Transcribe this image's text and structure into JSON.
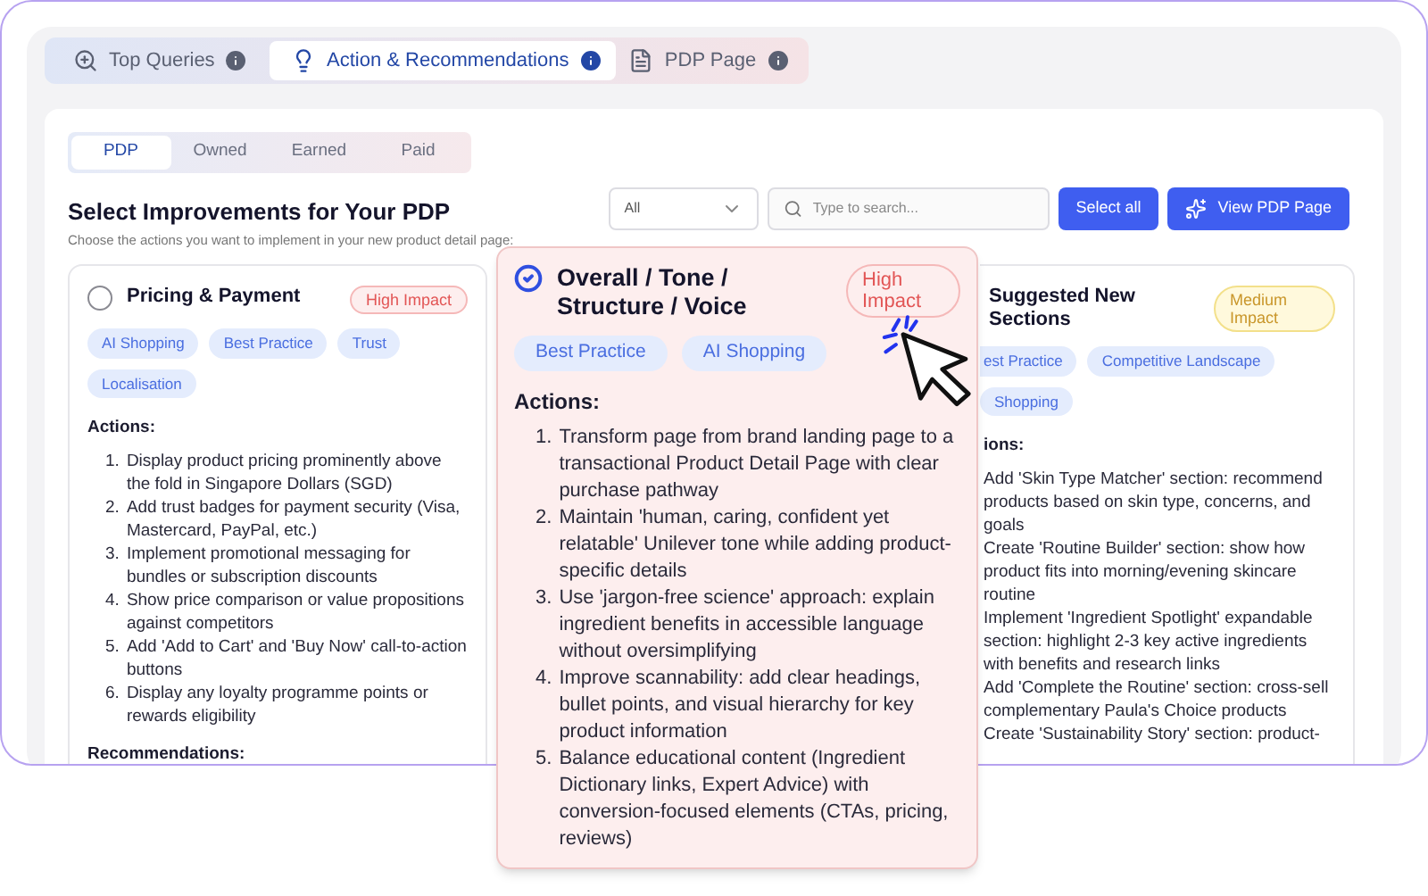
{
  "main_tabs": [
    {
      "label": "Top Queries",
      "selected": false
    },
    {
      "label": "Action & Recommendations",
      "selected": true
    },
    {
      "label": "PDP Page",
      "selected": false
    }
  ],
  "sub_tabs": [
    {
      "label": "PDP",
      "selected": true
    },
    {
      "label": "Owned",
      "selected": false
    },
    {
      "label": "Earned",
      "selected": false
    },
    {
      "label": "Paid",
      "selected": false
    }
  ],
  "heading": {
    "title": "Select Improvements for Your PDP",
    "subtitle": "Choose the actions you want to implement in your new product detail page:"
  },
  "filter": {
    "value": "All"
  },
  "search": {
    "placeholder": "Type to search..."
  },
  "buttons": [
    {
      "label": "Select all",
      "kind": "plain"
    },
    {
      "label": "View PDP Page",
      "kind": "sparkle"
    }
  ],
  "cards": [
    {
      "title": "Pricing & Payment",
      "selected": false,
      "impact": {
        "label": "High Impact",
        "kind": "high"
      },
      "tags": [
        "AI Shopping",
        "Best Practice",
        "Trust",
        "Localisation"
      ],
      "actions_heading": "Actions:",
      "actions": [
        {
          "number": "1.",
          "text": "Display product pricing prominently above the fold in Singapore Dollars (SGD)"
        },
        {
          "number": "2.",
          "text": "Add trust badges for payment security (Visa, Mastercard, PayPal, etc.)"
        },
        {
          "number": "3.",
          "text": "Implement promotional messaging for bundles or subscription discounts"
        },
        {
          "number": "4.",
          "text": "Show price comparison or value propositions against competitors"
        },
        {
          "number": "5.",
          "text": "Add 'Add to Cart' and 'Buy Now' call-to-action buttons"
        },
        {
          "number": "6.",
          "text": "Display any loyalty programme points or rewards eligibility"
        }
      ],
      "recommendations_heading": "Recommendations:"
    },
    {
      "title": "Suggested New Sections",
      "impact": {
        "label": "Medium Impact",
        "kind": "medium"
      },
      "tags": [
        "est Practice",
        "Competitive Landscape",
        "Shopping"
      ],
      "actions_heading": "ions:",
      "actions": [
        {
          "text": "Add 'Skin Type Matcher' section: recommend products based on skin type, concerns, and goals"
        },
        {
          "text": "Create 'Routine Builder' section: show how product fits into morning/evening skincare routine"
        },
        {
          "text": "Implement 'Ingredient Spotlight' expandable section: highlight 2-3 key active ingredients with benefits and research links"
        },
        {
          "text": "Add 'Complete the Routine' section: cross-sell complementary Paula's Choice products"
        },
        {
          "text": "Create 'Sustainability Story' section: product-"
        }
      ]
    }
  ],
  "highlighted_card": {
    "title": "Overall / Tone / Structure / Voice",
    "selected": true,
    "impact": {
      "label": "High Impact",
      "kind": "high"
    },
    "tags": [
      "Best Practice",
      "AI Shopping"
    ],
    "actions_heading": "Actions:",
    "actions": [
      {
        "number": "1.",
        "text": "Transform page from brand landing page to a transactional Product Detail Page with clear purchase pathway"
      },
      {
        "number": "2.",
        "text": "Maintain 'human, caring, confident yet relatable' Unilever tone while adding product-specific details"
      },
      {
        "number": "3.",
        "text": "Use 'jargon-free science' approach: explain ingredient benefits in accessible language without oversimplifying"
      },
      {
        "number": "4.",
        "text": "Improve scannability: add clear headings, bullet points, and visual hierarchy for key product information"
      },
      {
        "number": "5.",
        "text": "Balance educational content (Ingredient Dictionary links, Expert Advice) with conversion-focused elements (CTAs, pricing, reviews)"
      }
    ]
  }
}
